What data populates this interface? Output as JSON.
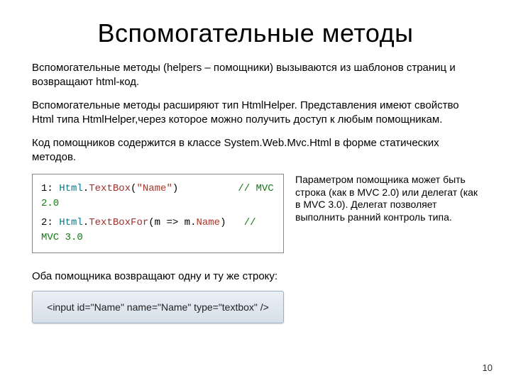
{
  "title": "Вспомогательные методы",
  "para1": "Вспомогательные методы (helpers – помощники) вызываются из шаблонов страниц и возвращают html-код.",
  "para2": "Вспомогательные методы расширяют тип HtmlHelper. Представления имеют свойство Html типа HtmlHelper,через которое можно получить доступ к любым помощникам.",
  "para3": "Код помощников содержится в классе System.Web.Mvc.Html в форме статических методов.",
  "code": {
    "line1": {
      "num": "1:",
      "cls": "Html",
      "dot1": ".",
      "meth": "TextBox",
      "open": "(",
      "str": "\"Name\"",
      "close": ")",
      "pad": "          ",
      "cmt": "// MVC 2.0"
    },
    "line2": {
      "num": "2:",
      "cls": "Html",
      "dot1": ".",
      "meth": "TextBoxFor",
      "open": "(m => m",
      "dot2": ".",
      "name": "Name",
      "close": ")",
      "pad": "   ",
      "cmt": "// MVC 3.0"
    }
  },
  "sidenote": "Параметром помощника может быть строка (как в MVC 2.0) или делегат (как в MVC 3.0). Делегат позволяет выполнить ранний контроль типа.",
  "outlabel": "Оба помощника возвращают одну и ту же строку:",
  "output": "<input id=\"Name\" name=\"Name\" type=\"textbox\" />",
  "pagenum": "10"
}
